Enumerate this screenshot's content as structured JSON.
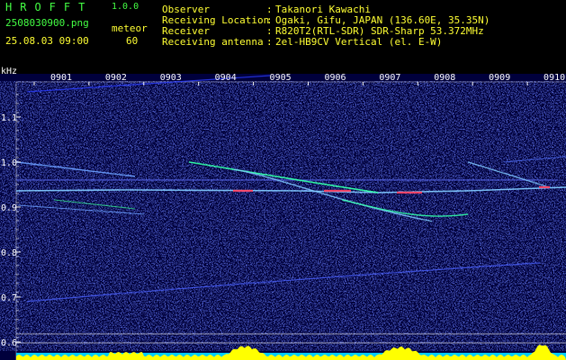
{
  "app": {
    "name": "HROFFT",
    "version": "1.0.0"
  },
  "file": {
    "name": "2508030900.png",
    "datetime": "25.08.03 09:00"
  },
  "meteor": {
    "label": "meteor",
    "count": "60"
  },
  "info": [
    {
      "label": "Observer",
      "sep": ":",
      "value": "Takanori Kawachi"
    },
    {
      "label": "Receiving Location",
      "sep": ":",
      "value": "Ogaki, Gifu, JAPAN (136.60E, 35.35N)"
    },
    {
      "label": "Receiver",
      "sep": ":",
      "value": "R820T2(RTL-SDR) SDR-Sharp 53.372MHz"
    },
    {
      "label": "Receiving antenna",
      "sep": ":",
      "value": "2el-HB9CV Vertical (el. E-W)"
    }
  ],
  "y_unit": "kHz",
  "time_ticks": [
    "0901",
    "0902",
    "0903",
    "0904",
    "0905",
    "0906",
    "0907",
    "0908",
    "0909",
    "0910"
  ],
  "freq_ticks": [
    "1.1",
    "1.0",
    "0.9",
    "0.8",
    "0.7",
    "0.6"
  ],
  "colors": {
    "bg": "#00003c",
    "noise": "#2b3cff",
    "trace_strong": "#ff4060",
    "trace_mid": "#33ffaa",
    "grid": "#ffffff",
    "level": "#ffff00",
    "level_base": "#00ccff"
  }
}
